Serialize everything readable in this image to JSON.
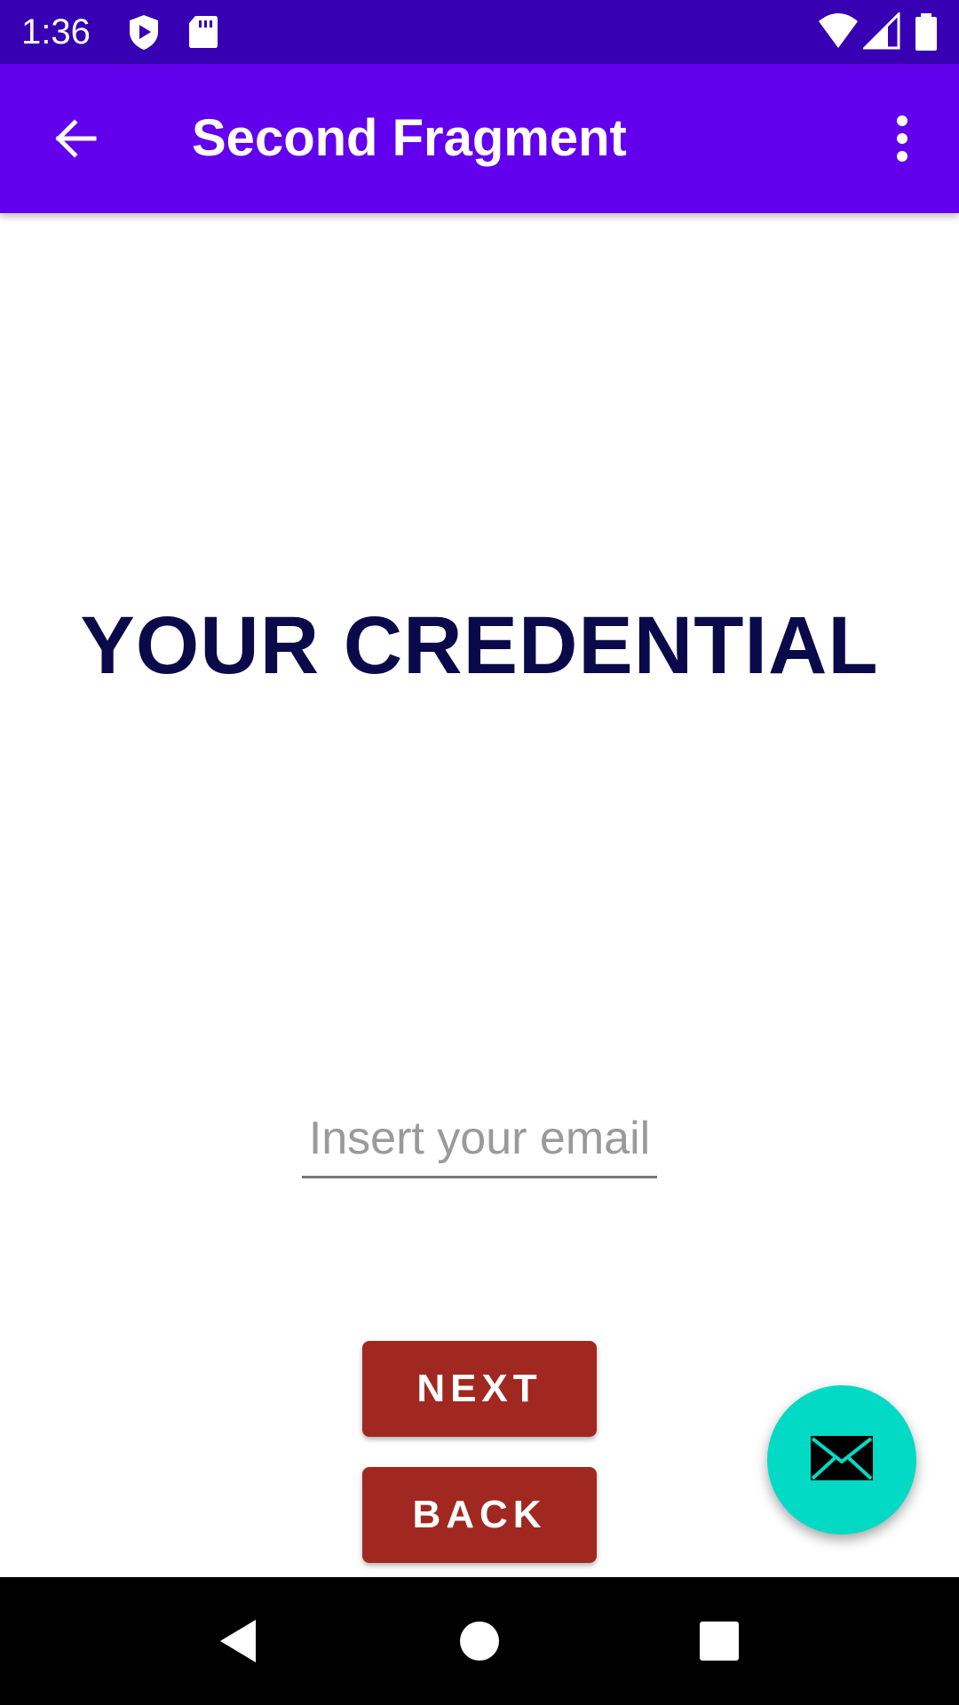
{
  "status_bar": {
    "time": "1:36",
    "left_icons": [
      "shield-play-icon",
      "sd-card-icon"
    ],
    "right_icons": [
      "wifi-icon",
      "cell-signal-icon",
      "battery-icon"
    ],
    "background_color": "#3700b3"
  },
  "app_bar": {
    "title": "Second Fragment",
    "back_icon": "arrow-back-icon",
    "menu_icon": "more-vert-icon",
    "background_color": "#6200ee"
  },
  "main": {
    "heading": "YOUR CREDENTIAL",
    "heading_color": "#0a0a4a",
    "email_input": {
      "placeholder": "Insert your email",
      "value": ""
    },
    "next_button_label": "NEXT",
    "back_button_label": "BACK",
    "button_color": "#a02820",
    "fab": {
      "icon": "mail-icon",
      "color": "#03dac6"
    }
  },
  "nav_bar": {
    "buttons": [
      "back-triangle-icon",
      "home-circle-icon",
      "recents-square-icon"
    ]
  }
}
